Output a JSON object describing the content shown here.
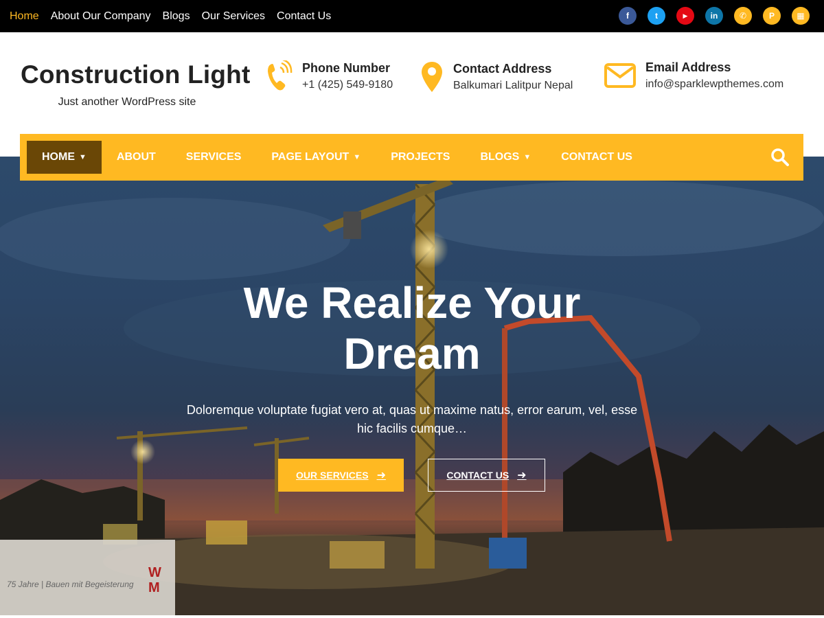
{
  "topbar": {
    "links": [
      "Home",
      "About Our Company",
      "Blogs",
      "Our Services",
      "Contact Us"
    ],
    "socials": [
      {
        "icon": "facebook-icon",
        "glyph": "f",
        "color": "#3b5998"
      },
      {
        "icon": "twitter-icon",
        "glyph": "t",
        "color": "#1da1f2"
      },
      {
        "icon": "youtube-icon",
        "glyph": "▶",
        "color": "#e50914"
      },
      {
        "icon": "linkedin-icon",
        "glyph": "in",
        "color": "#0e76a8"
      },
      {
        "icon": "phone-icon",
        "glyph": "✆",
        "color": "#ffb922"
      },
      {
        "icon": "pinterest-icon",
        "glyph": "P",
        "color": "#ffb922"
      },
      {
        "icon": "calendar-icon",
        "glyph": "▦",
        "color": "#ffb922"
      }
    ]
  },
  "header": {
    "title": "Construction Light",
    "tagline": "Just another WordPress site",
    "phone": {
      "title": "Phone Number",
      "value": "+1 (425) 549-9180"
    },
    "address": {
      "title": "Contact Address",
      "value": "Balkumari Lalitpur Nepal"
    },
    "email": {
      "title": "Email Address",
      "value": "info@sparklewpthemes.com"
    }
  },
  "nav": {
    "items": [
      "HOME",
      "ABOUT",
      "SERVICES",
      "PAGE LAYOUT",
      "PROJECTS",
      "BLOGS",
      "CONTACT US"
    ]
  },
  "hero": {
    "title": "We Realize Your Dream",
    "description": "Doloremque voluptate fugiat vero at, quas ut maxime natus, error earum, vel, esse hic facilis cumque…",
    "services_label": "OUR SERVICES",
    "contact_label": "CONTACT US"
  },
  "colors": {
    "accent": "#ffb922",
    "nav_active": "#6a4706",
    "topbar": "#000000"
  }
}
